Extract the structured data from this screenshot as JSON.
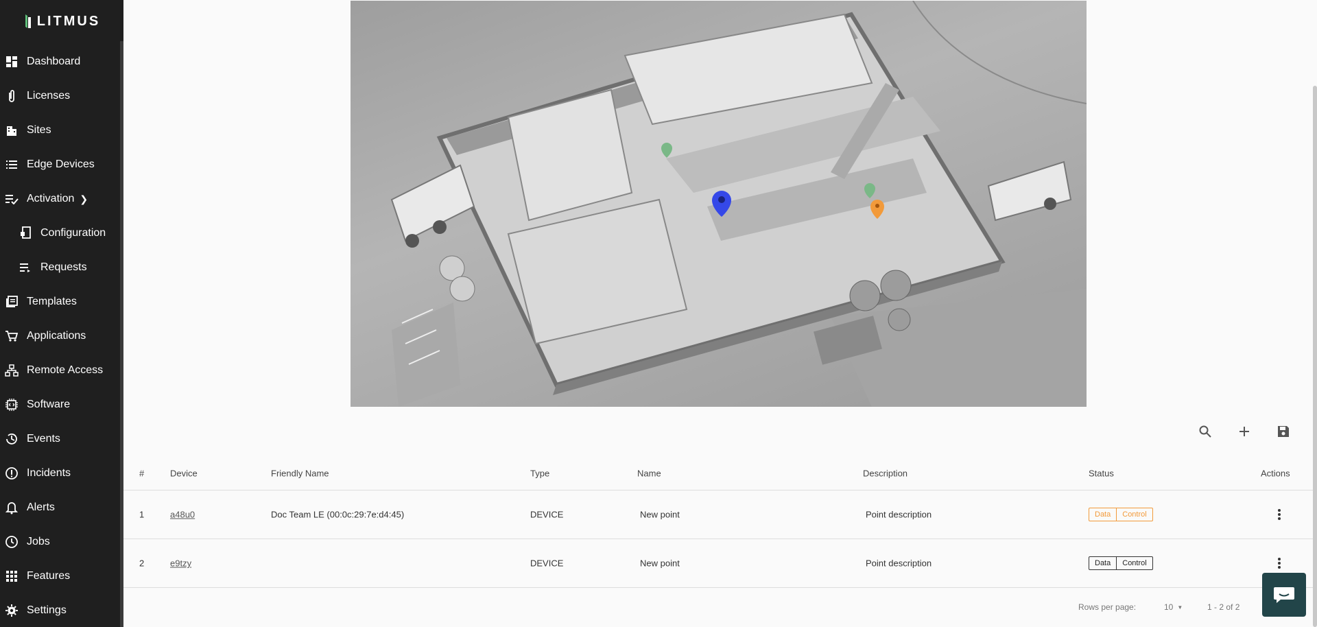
{
  "brand": {
    "logo_text": "LITMUS"
  },
  "sidebar": {
    "items": [
      {
        "label": "Dashboard",
        "icon": "dashboard-icon"
      },
      {
        "label": "Licenses",
        "icon": "paperclip-icon"
      },
      {
        "label": "Sites",
        "icon": "building-icon"
      },
      {
        "label": "Edge Devices",
        "icon": "list-icon"
      },
      {
        "label": "Activation",
        "icon": "checklist-icon",
        "expandable": true
      },
      {
        "label": "Configuration",
        "icon": "config-icon",
        "sub": true
      },
      {
        "label": "Requests",
        "icon": "requests-icon",
        "sub": true
      },
      {
        "label": "Templates",
        "icon": "templates-icon"
      },
      {
        "label": "Applications",
        "icon": "cart-icon"
      },
      {
        "label": "Remote Access",
        "icon": "network-icon"
      },
      {
        "label": "Software",
        "icon": "chip-icon"
      },
      {
        "label": "Events",
        "icon": "history-icon"
      },
      {
        "label": "Incidents",
        "icon": "alert-circle-icon"
      },
      {
        "label": "Alerts",
        "icon": "bell-icon"
      },
      {
        "label": "Jobs",
        "icon": "clock-icon"
      },
      {
        "label": "Features",
        "icon": "grid-icon"
      },
      {
        "label": "Settings",
        "icon": "gear-icon"
      }
    ]
  },
  "toolbar": {
    "icons": [
      "search-icon",
      "add-icon",
      "save-icon"
    ]
  },
  "table": {
    "columns": [
      "#",
      "Device",
      "Friendly Name",
      "Type",
      "Name",
      "Description",
      "Status",
      "Actions"
    ],
    "rows": [
      {
        "index": "1",
        "device": "a48u0",
        "friendly_name": "Doc Team LE (00:0c:29:7e:d4:45)",
        "type": "DEVICE",
        "name": "New point",
        "description": "Point description",
        "status_data": "Data",
        "status_control": "Control",
        "status_color": "#f29a3a"
      },
      {
        "index": "2",
        "device": "e9tzy",
        "friendly_name": "",
        "type": "DEVICE",
        "name": "New point",
        "description": "Point description",
        "status_data": "Data",
        "status_control": "Control",
        "status_color": "#333333"
      }
    ]
  },
  "pagination": {
    "rows_per_page_label": "Rows per page:",
    "rows_per_page_value": "10",
    "range": "1 - 2 of 2"
  },
  "colors": {
    "sidebar_bg": "#1f1f1f",
    "accent_orange": "#f29a3a",
    "chat_bg": "#224549"
  }
}
